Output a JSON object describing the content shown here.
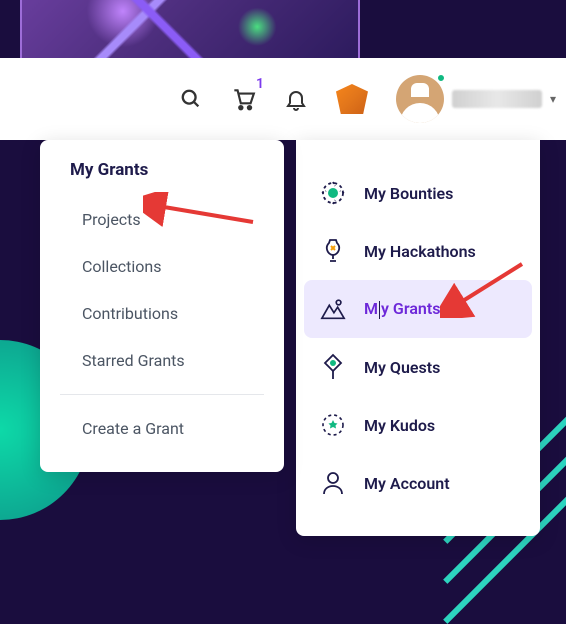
{
  "navbar": {
    "cart_count": "1"
  },
  "right_menu": {
    "items": [
      {
        "label": "My Bounties"
      },
      {
        "label": "My Hackathons"
      },
      {
        "label": "My Grants"
      },
      {
        "label": "My Quests"
      },
      {
        "label": "My Kudos"
      },
      {
        "label": "My Account"
      }
    ]
  },
  "left_menu": {
    "title": "My Grants",
    "items": [
      {
        "label": "Projects"
      },
      {
        "label": "Collections"
      },
      {
        "label": "Contributions"
      },
      {
        "label": "Starred Grants"
      }
    ],
    "create": "Create a Grant"
  },
  "colors": {
    "highlight_bg": "#ede9fe",
    "highlight_fg": "#6d28d9",
    "arrow": "#e53935"
  }
}
